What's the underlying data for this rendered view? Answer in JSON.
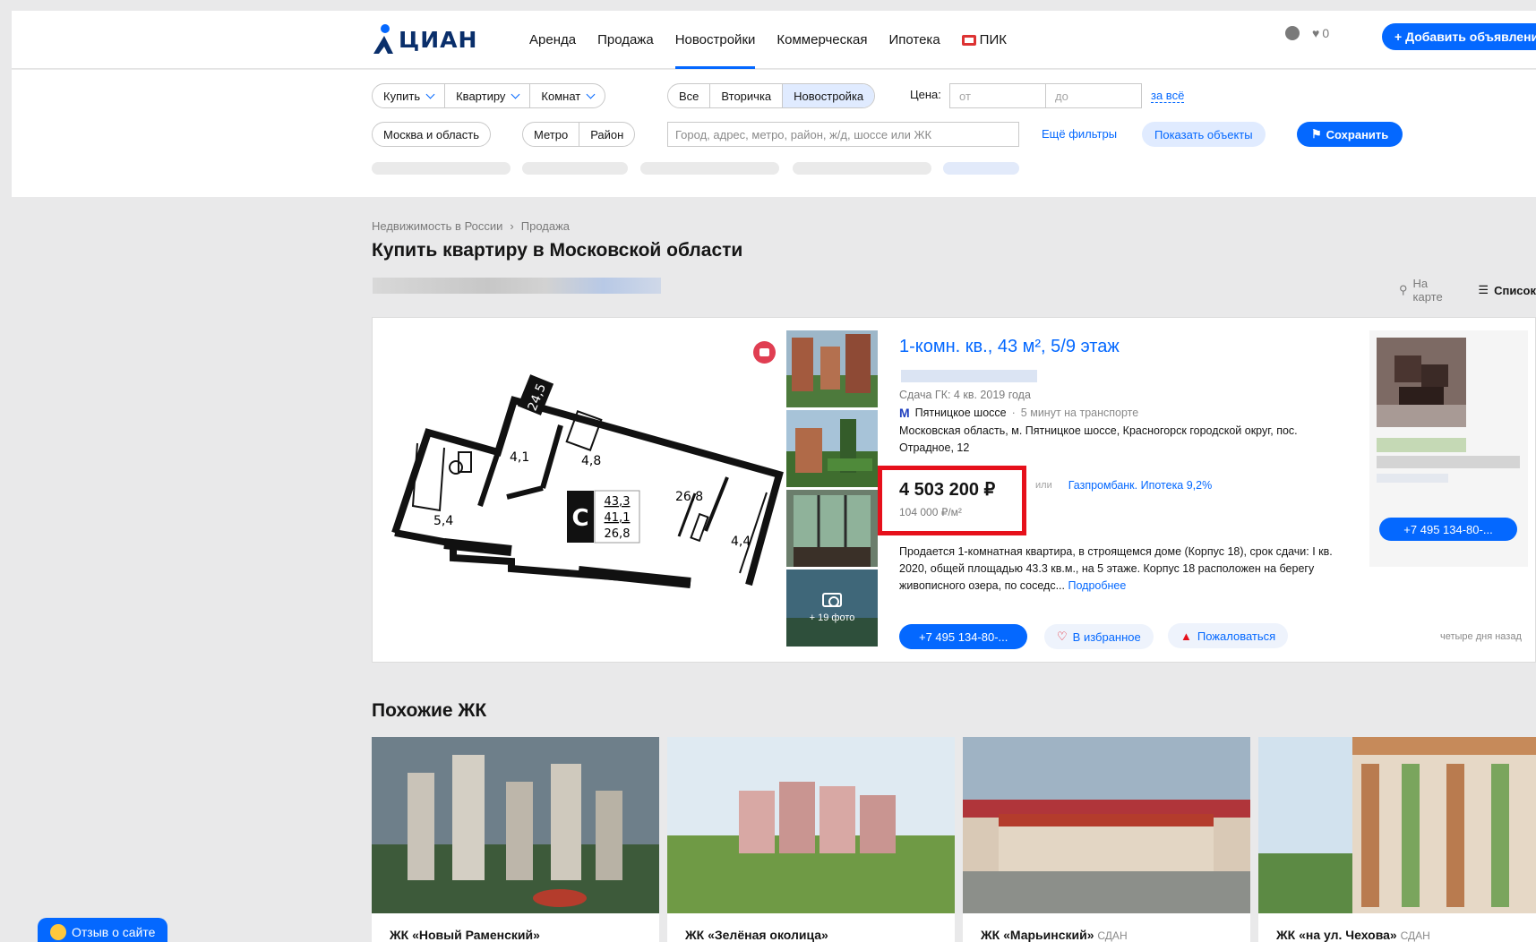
{
  "header": {
    "logo": "ЦИАН",
    "nav": [
      "Аренда",
      "Продажа",
      "Новостройки",
      "Коммерческая",
      "Ипотека",
      "ПИК"
    ],
    "active_nav": "Новостройки",
    "favorites_count": "0",
    "add_button": "+ Добавить объявление"
  },
  "filters": {
    "deal": "Купить",
    "object": "Квартиру",
    "rooms": "Комнат",
    "market": [
      "Все",
      "Вторичка",
      "Новостройка"
    ],
    "price_label": "Цена:",
    "price_from_placeholder": "от",
    "price_to_placeholder": "до",
    "price_unit_link": "за всё",
    "region": "Москва и область",
    "metro": "Метро",
    "district": "Район",
    "address_placeholder": "Город, адрес, метро, район, ж/д, шоссе или ЖК",
    "more_filters": "Ещё фильтры",
    "show_objects": "Показать объекты",
    "save": "Сохранить"
  },
  "breadcrumbs": [
    "Недвижимость в России",
    "Продажа"
  ],
  "page_title": "Купить квартиру в Московской области",
  "view_toggle": {
    "map": "На карте",
    "list": "Список"
  },
  "listing": {
    "title": "1-комн. кв., 43 м², 5/9 этаж",
    "deadline": "Сдача ГК: 4 кв. 2019 года",
    "metro": "Пятницкое шоссе",
    "metro_time": "5 минут на транспорте",
    "address": "Московская область, м. Пятницкое шоссе, Красногорск городской округ, пос. Отрадное, 12",
    "price": "4 503 200 ₽",
    "price_per_m2": "104 000 ₽/м²",
    "or": "или",
    "mortgage": "Газпромбанк. Ипотека 9,2%",
    "description": "Продается 1-комнатная квартира, в строящемся доме (Корпус 18), срок сдачи: I кв. 2020, общей площадью 43.3 кв.м., на 5 этаже. Корпус 18 расположен на берегу живописного озера, по соседс...",
    "more_link": "Подробнее",
    "phone": "+7 495 134-80-...",
    "favorite": "В избранное",
    "complain": "Пожаловаться",
    "time_ago": "четыре дня назад",
    "more_photos": "+ 19 фото",
    "agent_phone": "+7 495 134-80-...",
    "plan": {
      "class_letter": "C",
      "areas_box": [
        "43,3",
        "41,1",
        "26,8"
      ],
      "rooms": [
        "24,5",
        "4,1",
        "4,8",
        "5,4",
        "26,8",
        "4,4"
      ]
    }
  },
  "similar": {
    "title": "Похожие ЖК",
    "items": [
      {
        "name": "ЖК «Новый Раменский»",
        "status": ""
      },
      {
        "name": "ЖК «Зелёная околица»",
        "status": ""
      },
      {
        "name": "ЖК «Марьинский»",
        "status": "СДАН"
      },
      {
        "name": "ЖК «на ул. Чехова»",
        "status": "СДАН"
      }
    ]
  },
  "feedback": "Отзыв о сайте",
  "colors": {
    "accent": "#0468ff",
    "highlight": "#e6101b",
    "logo": "#0a2f6b"
  }
}
